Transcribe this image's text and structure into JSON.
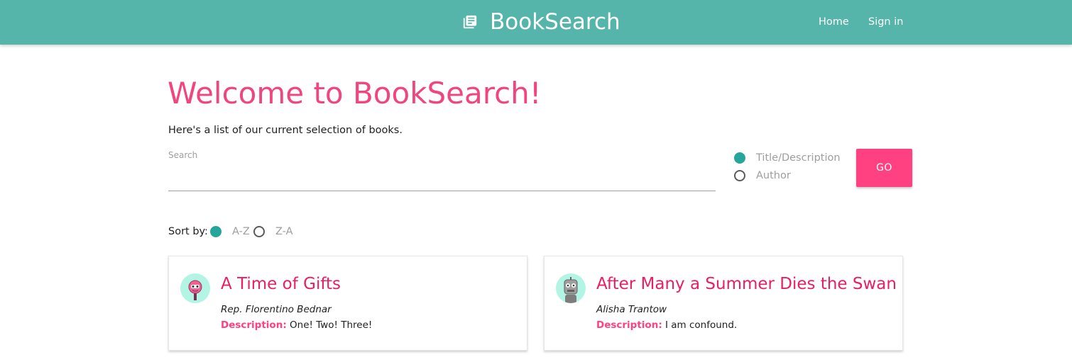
{
  "header": {
    "brand": "BookSearch",
    "nav": {
      "home": "Home",
      "sign_in": "Sign in"
    }
  },
  "main": {
    "title": "Welcome to BookSearch!",
    "intro": "Here's a list of our current selection of books.",
    "search": {
      "label": "Search",
      "value": "",
      "placeholder": ""
    },
    "search_by": {
      "options": [
        {
          "label": "Title/Description",
          "selected": true
        },
        {
          "label": "Author",
          "selected": false
        }
      ]
    },
    "go_label": "GO",
    "sort": {
      "label": "Sort by:",
      "options": [
        {
          "label": "A-Z",
          "selected": true
        },
        {
          "label": "Z-A",
          "selected": false
        }
      ]
    },
    "books": [
      {
        "title": "A Time of Gifts",
        "author": "Rep. Florentino Bednar",
        "description_label": "Description:",
        "description": "One! Two! Three!",
        "avatar_icon": "pink-robot-avatar-icon"
      },
      {
        "title": "After Many a Summer Dies the Swan",
        "author": "Alisha Trantow",
        "description_label": "Description:",
        "description": "I am confound.",
        "avatar_icon": "gray-robot-avatar-icon"
      }
    ]
  },
  "colors": {
    "navbar": "#55b5aa",
    "accent_pink": "#ff4081",
    "title_pink": "#f0457f",
    "radio_teal": "#26a69a",
    "avatar_bg": "#b2f5e4"
  }
}
